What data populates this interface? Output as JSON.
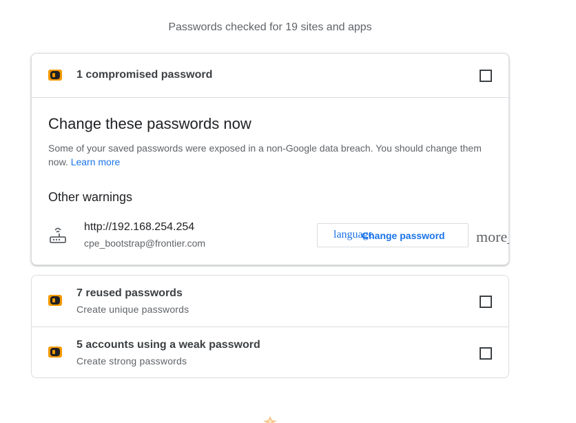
{
  "summary": "Passwords checked for 19 sites and apps",
  "compromised": {
    "header_title": "1 compromised password",
    "section_title": "Change these passwords now",
    "description": "Some of your saved passwords were exposed in a non-Google data breach. You should change them now.",
    "learn_more": "Learn more",
    "other_warnings": "Other warnings",
    "entry": {
      "url": "http://192.168.254.254",
      "username": "cpe_bootstrap@frontier.com",
      "button_icon_text": "language",
      "button_label": "Change password",
      "more_label": "more_vert"
    }
  },
  "reused": {
    "title": "7 reused passwords",
    "subtitle": "Create unique passwords"
  },
  "weak": {
    "title": "5 accounts using a weak password",
    "subtitle": "Create strong passwords"
  },
  "colors": {
    "warning": "#f29900",
    "accent": "#1a73e8",
    "border": "#dadce0"
  },
  "icons": [
    "warning-icon",
    "router-icon",
    "checkbox-icon",
    "language-icon",
    "more-vert-icon"
  ]
}
